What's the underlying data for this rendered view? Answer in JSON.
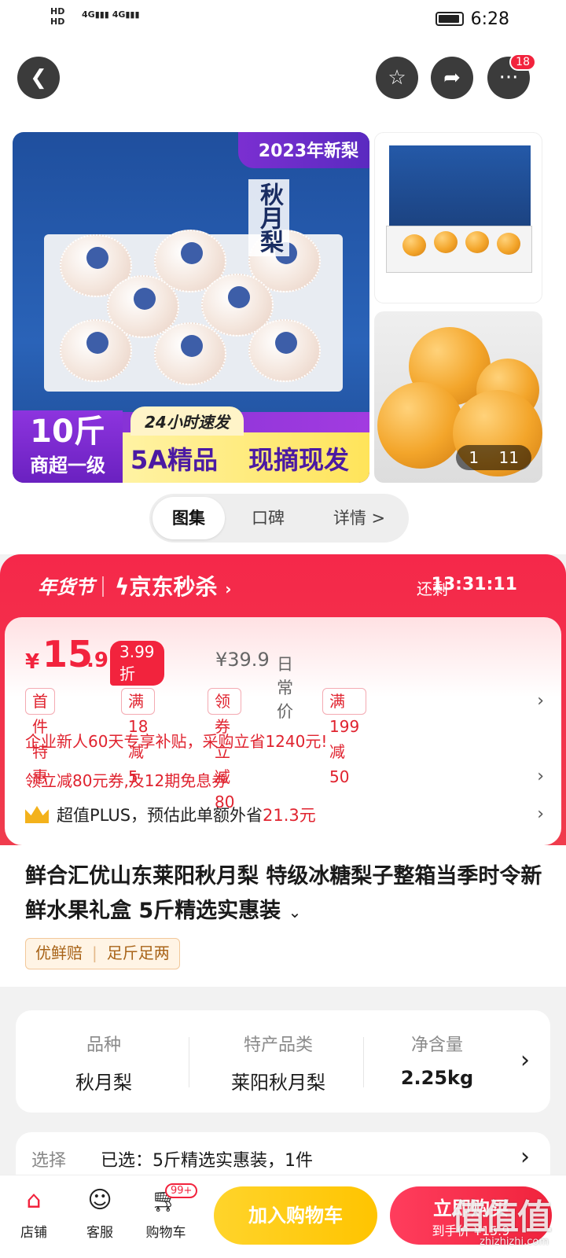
{
  "status": {
    "net1": "HD",
    "net2": "HD",
    "sig1": "4G",
    "sig2": "4G",
    "time": "6:28"
  },
  "header": {
    "more_badge": "18"
  },
  "gallery": {
    "ribbon": "2023年新梨",
    "box_text": "秋月梨",
    "badge_weight": "10斤",
    "badge_grade": "商超一级",
    "ship_tag": "24小时速发",
    "quality": "5A精品",
    "fresh": "现摘现发",
    "counter_current": "1",
    "counter_total": "11"
  },
  "tabs": [
    {
      "label": "图集"
    },
    {
      "label": "口碑"
    },
    {
      "label": "详情 >"
    }
  ],
  "promo": {
    "festival": "年货节",
    "seckill": "京东秒杀",
    "remaining_label": "还剩",
    "countdown": "13:31:11",
    "price_symbol": "¥",
    "price_int": "15",
    "price_dec": ".9",
    "discount": "3.99折",
    "original_price": "¥39.9",
    "original_label": "日常价",
    "coupons": [
      "首件特惠",
      "满18减5",
      "领券立减80",
      "满199减50"
    ],
    "enterprise": "企业新人60天专享补贴，采购立省1240元!",
    "coupon_line": "领立减80元券,及12期免息券",
    "plus_prefix": "超值PLUS，预估此单额外省",
    "plus_amount": "21.3元"
  },
  "product": {
    "title": "鲜合汇优山东莱阳秋月梨 特级冰糖梨子整箱当季时令新鲜水果礼盒 5斤精选实惠装",
    "tag1": "优鲜赔",
    "tag2": "足斤足两"
  },
  "specs": [
    {
      "key": "品种",
      "value": "秋月梨"
    },
    {
      "key": "特产品类",
      "value": "莱阳秋月梨"
    },
    {
      "key": "净含量",
      "value": "2.25kg"
    }
  ],
  "selection": {
    "label": "选择",
    "value": "已选：5斤精选实惠装，1件"
  },
  "bottom": {
    "shop": "店铺",
    "service": "客服",
    "cart": "购物车",
    "cart_badge": "99+",
    "add_cart": "加入购物车",
    "buy_now": "立即购买",
    "buy_price": "到手价 ¥15.9"
  },
  "watermark": {
    "main": "值值值",
    "sub": "zhizhizhi.com"
  },
  "colors": {
    "accent": "#f2233d",
    "yellow": "#ffc400"
  }
}
